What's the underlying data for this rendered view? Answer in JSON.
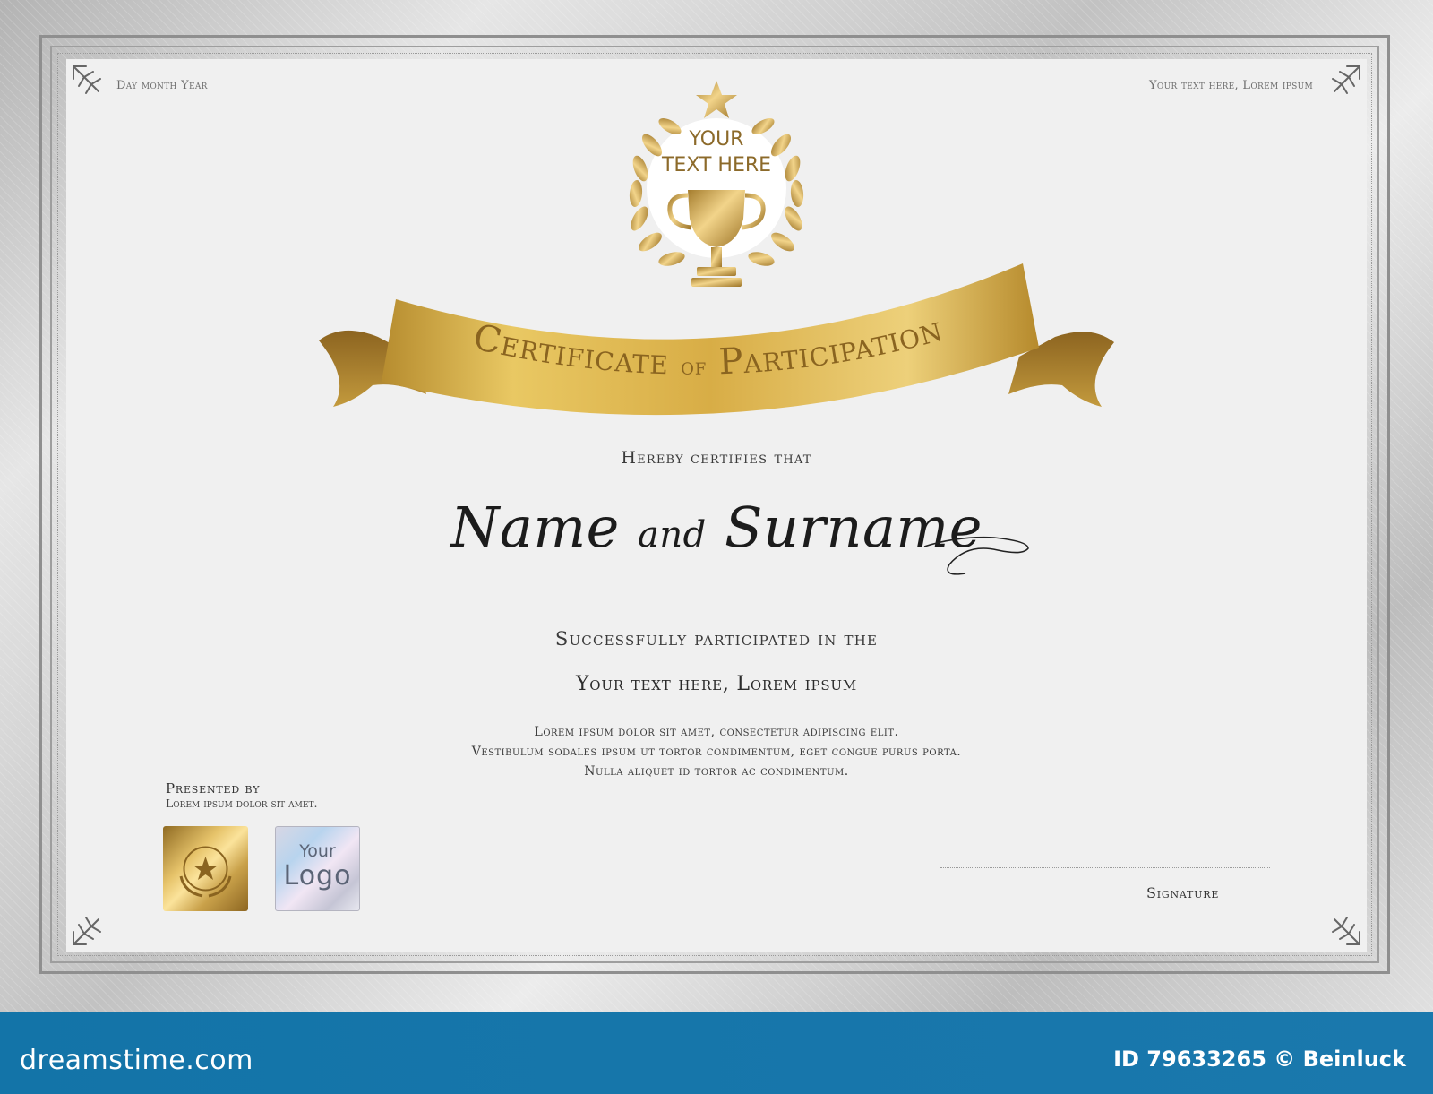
{
  "certificate": {
    "date_label": "Day month Year",
    "top_right_text": "Your text here, Lorem ipsum",
    "emblem_text": [
      "YOUR",
      "TEXT HERE"
    ],
    "ribbon_title": {
      "part1": "Certificate",
      "connector": "of",
      "part2": "Participation"
    },
    "certifies": "Hereby certifies that",
    "name": {
      "first": "Name",
      "connector": "and",
      "last": "Surname"
    },
    "participated": "Successfully participated in the",
    "event": "Your text here, Lorem ipsum",
    "body_lines": [
      "Lorem ipsum dolor sit amet, consectetur adipiscing elit.",
      "Vestibulum sodales ipsum ut tortor condimentum, eget congue purus porta.",
      "Nulla aliquet id tortor ac condimentum."
    ],
    "presented_by": "Presented by",
    "presented_by_sub": "Lorem ipsum dolor sit amet.",
    "logo": {
      "line1": "Your",
      "line2": "Logo"
    },
    "signature_label": "Signature"
  },
  "footer": {
    "brand": "dreamstime.com",
    "id_text": "ID 79633265 © Beinluck"
  },
  "colors": {
    "gold": "#c9a44c",
    "footer_blue": "#1374a8",
    "panel": "#f0f0f0",
    "frame_silver": "#c8c8c8"
  }
}
